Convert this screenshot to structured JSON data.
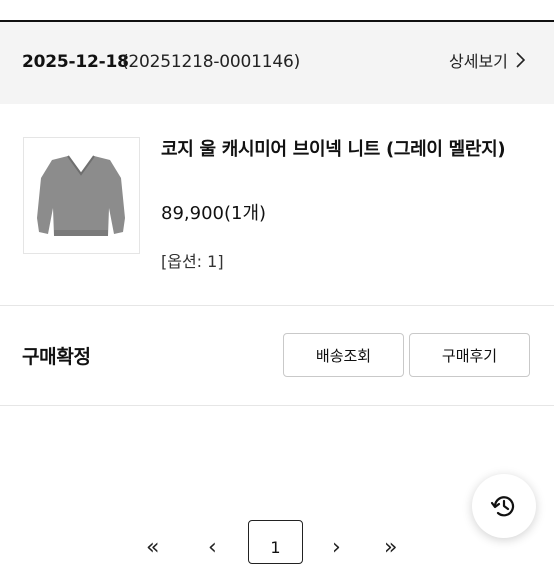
{
  "order": {
    "date": "2025-12-18",
    "number": "(20251218-0001146)",
    "detail_label": "상세보기"
  },
  "product": {
    "name": "코지 울 캐시미어 브이넥 니트 (그레이 멜란지)",
    "price": "89,900(1개)",
    "option": "[옵션: 1]",
    "image_color": "#8a8a8a"
  },
  "status": {
    "label": "구매확정"
  },
  "actions": {
    "track_label": "배송조회",
    "review_label": "구매후기"
  },
  "pagination": {
    "first": "«",
    "prev": "‹",
    "current": "1",
    "next": "›",
    "last": "»"
  },
  "floating": {
    "icon": "history-icon"
  }
}
